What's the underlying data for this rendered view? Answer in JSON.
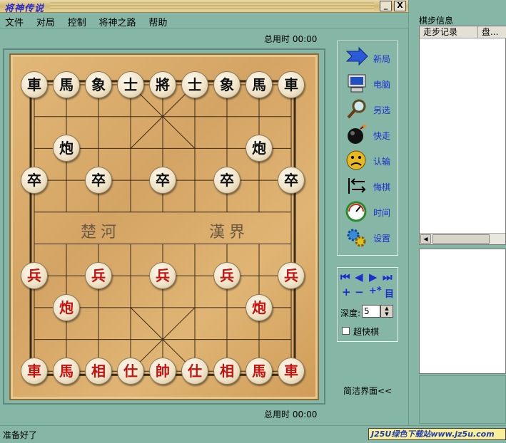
{
  "window": {
    "title": "将神传说",
    "minimize": "_",
    "close": "X"
  },
  "menu": [
    "文件",
    "对局",
    "控制",
    "将神之路",
    "帮助"
  ],
  "timers": {
    "top": "总用时 00:00",
    "bottom": "总用时 00:00"
  },
  "board": {
    "river_left": "楚河",
    "river_right": "漢界",
    "black_pieces": [
      {
        "char": "車",
        "col": 0,
        "row": 0
      },
      {
        "char": "馬",
        "col": 1,
        "row": 0
      },
      {
        "char": "象",
        "col": 2,
        "row": 0
      },
      {
        "char": "士",
        "col": 3,
        "row": 0
      },
      {
        "char": "將",
        "col": 4,
        "row": 0
      },
      {
        "char": "士",
        "col": 5,
        "row": 0
      },
      {
        "char": "象",
        "col": 6,
        "row": 0
      },
      {
        "char": "馬",
        "col": 7,
        "row": 0
      },
      {
        "char": "車",
        "col": 8,
        "row": 0
      },
      {
        "char": "炮",
        "col": 1,
        "row": 2
      },
      {
        "char": "炮",
        "col": 7,
        "row": 2
      },
      {
        "char": "卒",
        "col": 0,
        "row": 3
      },
      {
        "char": "卒",
        "col": 2,
        "row": 3
      },
      {
        "char": "卒",
        "col": 4,
        "row": 3
      },
      {
        "char": "卒",
        "col": 6,
        "row": 3
      },
      {
        "char": "卒",
        "col": 8,
        "row": 3
      }
    ],
    "red_pieces": [
      {
        "char": "兵",
        "col": 0,
        "row": 6
      },
      {
        "char": "兵",
        "col": 2,
        "row": 6
      },
      {
        "char": "兵",
        "col": 4,
        "row": 6
      },
      {
        "char": "兵",
        "col": 6,
        "row": 6
      },
      {
        "char": "兵",
        "col": 8,
        "row": 6
      },
      {
        "char": "炮",
        "col": 1,
        "row": 7
      },
      {
        "char": "炮",
        "col": 7,
        "row": 7
      },
      {
        "char": "車",
        "col": 0,
        "row": 9
      },
      {
        "char": "馬",
        "col": 1,
        "row": 9
      },
      {
        "char": "相",
        "col": 2,
        "row": 9
      },
      {
        "char": "仕",
        "col": 3,
        "row": 9
      },
      {
        "char": "帥",
        "col": 4,
        "row": 9
      },
      {
        "char": "仕",
        "col": 5,
        "row": 9
      },
      {
        "char": "相",
        "col": 6,
        "row": 9
      },
      {
        "char": "馬",
        "col": 7,
        "row": 9
      },
      {
        "char": "車",
        "col": 8,
        "row": 9
      }
    ]
  },
  "toolbar": [
    {
      "label": "新局",
      "icon": "arrow-icon"
    },
    {
      "label": "电脑",
      "icon": "computer-icon"
    },
    {
      "label": "另选",
      "icon": "magnifier-icon"
    },
    {
      "label": "快走",
      "icon": "bomb-icon"
    },
    {
      "label": "认输",
      "icon": "sad-face-icon"
    },
    {
      "label": "悔棋",
      "icon": "undo-arrows-icon"
    },
    {
      "label": "时间",
      "icon": "clock-icon"
    },
    {
      "label": "设置",
      "icon": "gears-icon"
    }
  ],
  "nav": {
    "first": "⏮",
    "prev": "◀",
    "next": "▶",
    "last": "⏭",
    "plus": "+",
    "minus": "−",
    "plus_star": "+*",
    "list": "目",
    "depth_label": "深度:",
    "depth_value": "5",
    "fast_label": "超快棋",
    "fast_checked": false
  },
  "simple_ui": "简洁界面<<",
  "moves_panel": {
    "title": "棋步信息",
    "col1": "走步记录",
    "col2": "盘..."
  },
  "status": "准备好了",
  "watermark": "J25U绿色下载站www.jz5u.com"
}
